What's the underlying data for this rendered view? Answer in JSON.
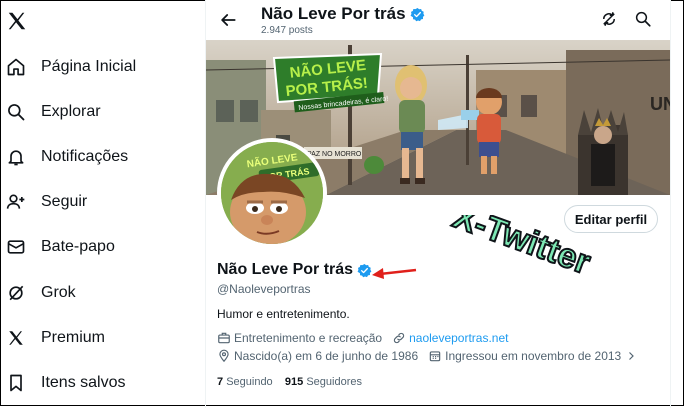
{
  "sidebar": {
    "logo_icon": "x-logo-icon",
    "items": [
      {
        "label": "Página Inicial",
        "icon": "home-icon"
      },
      {
        "label": "Explorar",
        "icon": "search-icon"
      },
      {
        "label": "Notificações",
        "icon": "bell-icon"
      },
      {
        "label": "Seguir",
        "icon": "add-person-icon"
      },
      {
        "label": "Bate-papo",
        "icon": "envelope-icon"
      },
      {
        "label": "Grok",
        "icon": "grok-icon"
      },
      {
        "label": "Premium",
        "icon": "x-logo-icon"
      },
      {
        "label": "Itens salvos",
        "icon": "bookmark-icon"
      }
    ]
  },
  "header": {
    "title": "Não Leve Por trás",
    "posts": "2.947 posts"
  },
  "banner": {
    "logo_text_line1": "NÃO LEVE",
    "logo_text_line2": "POR TRÁS!",
    "tagline": "Nossas brincadeiras, é claro!",
    "sign_text": "PAZ NO MORRO",
    "wall_text": "UN"
  },
  "avatar": {
    "text_line1": "NÃO LEVE",
    "text_line2": "POR TRÁS"
  },
  "profile": {
    "edit_label": "Editar perfil",
    "name": "Não Leve Por trás",
    "handle": "@Naoleveportras",
    "bio": "Humor e entretenimento.",
    "category": "Entretenimento e recreação",
    "website": "naoleveportras.net",
    "birth": "Nascido(a) em 6 de junho de 1986",
    "joined": "Ingressou em novembro de 2013",
    "following_count": "7",
    "following_label": "Seguindo",
    "followers_count": "915",
    "followers_label": "Seguidores"
  },
  "watermark": {
    "text": "X-Twitter"
  },
  "colors": {
    "verified": "#1d9bf0",
    "link": "#1d9bf0",
    "annotation_arrow": "#e0201b",
    "watermark_fill": "#7de8b4"
  }
}
